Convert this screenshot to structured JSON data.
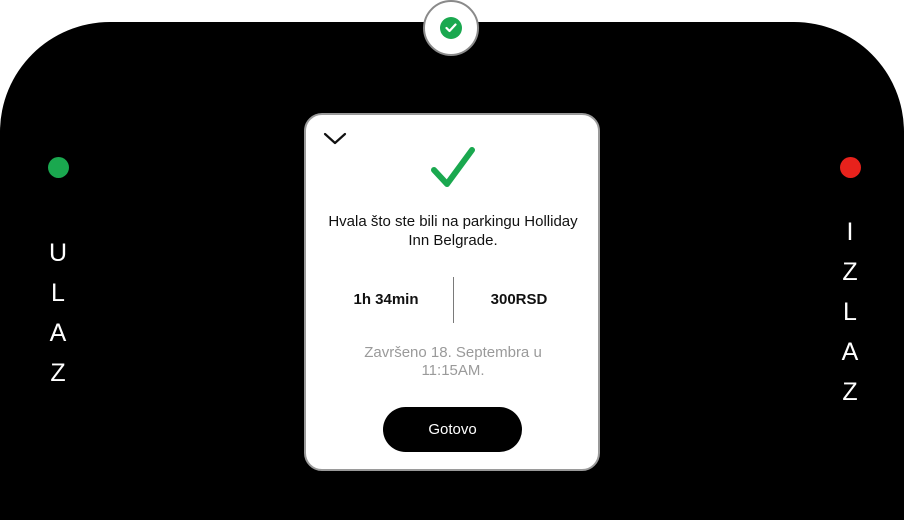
{
  "entry_label": [
    "U",
    "L",
    "A",
    "Z"
  ],
  "exit_label": [
    "I",
    "Z",
    "L",
    "A",
    "Z"
  ],
  "colors": {
    "entry_light": "#1aa84f",
    "exit_light": "#e8221c",
    "success": "#1aa84f"
  },
  "icons": {
    "top_badge": "check-circle-icon",
    "collapse": "chevron-down-icon",
    "success": "checkmark-icon"
  },
  "card": {
    "message": "Hvala što ste bili na parkingu Holliday Inn Belgrade.",
    "duration": "1h 34min",
    "price": "300RSD",
    "completed_text": "Završeno 18. Septembra u 11:15AM.",
    "done_button": "Gotovo"
  }
}
